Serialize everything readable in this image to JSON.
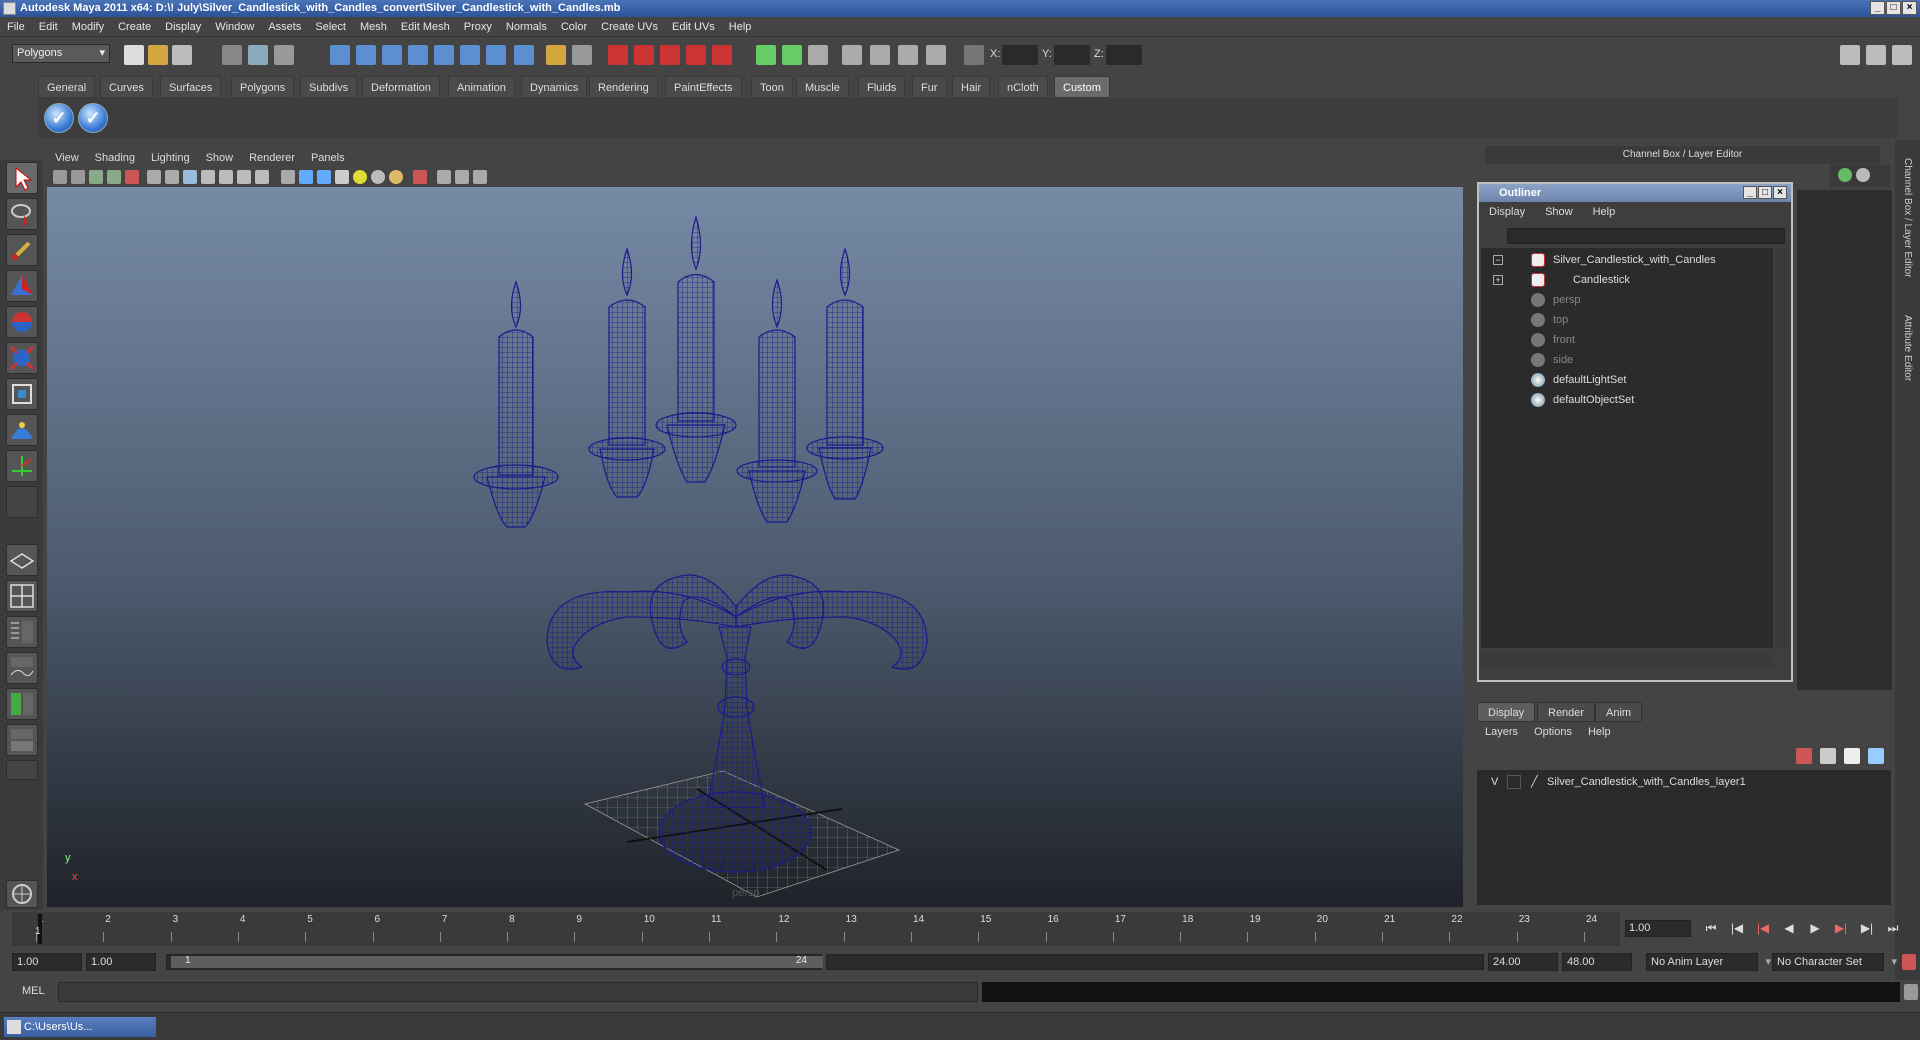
{
  "title": "Autodesk Maya 2011 x64: D:\\! July\\Silver_Candlestick_with_Candles_convert\\Silver_Candlestick_with_Candles.mb",
  "menubar": [
    "File",
    "Edit",
    "Modify",
    "Create",
    "Display",
    "Window",
    "Assets",
    "Select",
    "Mesh",
    "Edit Mesh",
    "Proxy",
    "Normals",
    "Color",
    "Create UVs",
    "Edit UVs",
    "Help"
  ],
  "status": {
    "mode": "Polygons",
    "x_label": "X:",
    "y_label": "Y:",
    "z_label": "Z:"
  },
  "shelf_tabs": [
    "General",
    "Curves",
    "Surfaces",
    "Polygons",
    "Subdivs",
    "Deformation",
    "Animation",
    "Dynamics",
    "Rendering",
    "PaintEffects",
    "Toon",
    "Muscle",
    "Fluids",
    "Fur",
    "Hair",
    "nCloth",
    "Custom"
  ],
  "active_shelf": "Custom",
  "panel_menu": [
    "View",
    "Shading",
    "Lighting",
    "Show",
    "Renderer",
    "Panels"
  ],
  "viewport": {
    "camera": "persp",
    "axis_y": "y",
    "axis_x": "x"
  },
  "channel_box_title": "Channel Box / Layer Editor",
  "side_tabs": [
    "Channel Box / Layer Editor",
    "Attribute Editor"
  ],
  "outliner": {
    "title": "Outliner",
    "menu": [
      "Display",
      "Show",
      "Help"
    ],
    "items": [
      {
        "label": "Silver_Candlestick_with_Candles",
        "type": "transform",
        "expander": "−"
      },
      {
        "label": "Candlestick",
        "type": "transform",
        "expander": "+"
      },
      {
        "label": "persp",
        "type": "camera",
        "dim": true
      },
      {
        "label": "top",
        "type": "camera",
        "dim": true
      },
      {
        "label": "front",
        "type": "camera",
        "dim": true
      },
      {
        "label": "side",
        "type": "camera",
        "dim": true
      },
      {
        "label": "defaultLightSet",
        "type": "set"
      },
      {
        "label": "defaultObjectSet",
        "type": "set"
      }
    ]
  },
  "layer_editor": {
    "tabs": [
      "Display",
      "Render",
      "Anim"
    ],
    "active_tab": "Display",
    "menu": [
      "Layers",
      "Options",
      "Help"
    ],
    "layer": {
      "visible": "V",
      "name": "Silver_Candlestick_with_Candles_layer1"
    }
  },
  "timeline": {
    "ticks": [
      "1",
      "2",
      "3",
      "4",
      "5",
      "6",
      "7",
      "8",
      "9",
      "10",
      "11",
      "12",
      "13",
      "14",
      "15",
      "16",
      "17",
      "18",
      "19",
      "20",
      "21",
      "22",
      "23",
      "24"
    ],
    "current_frame": "1.00",
    "current_marker": "1"
  },
  "range": {
    "start": "1.00",
    "play_start": "1.00",
    "slider_start": "1",
    "slider_end": "24",
    "play_end": "24.00",
    "end": "48.00",
    "anim_layer": "No Anim Layer",
    "character_set": "No Character Set"
  },
  "mel_label": "MEL",
  "taskbar": {
    "item": "C:\\Users\\Us..."
  },
  "colors": {
    "wireframe": "#1a1a8c",
    "titlebar": "#3a62a8"
  }
}
